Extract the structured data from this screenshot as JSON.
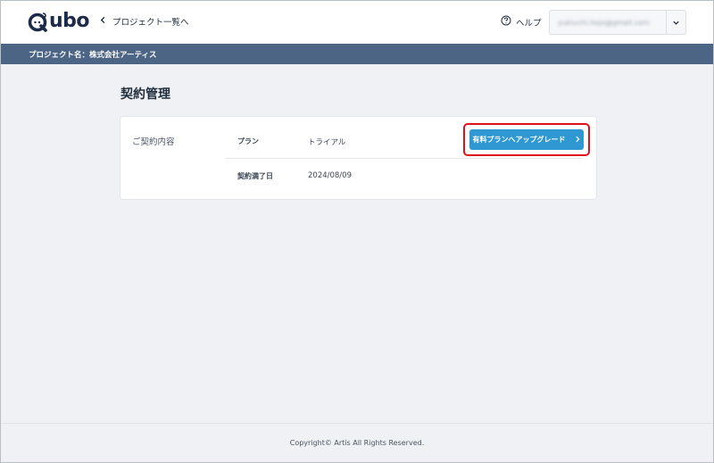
{
  "header": {
    "logo_text": "ubo",
    "back_label": "プロジェクト一覧へ",
    "help_label": "ヘルプ",
    "user_email": "yukiuchi.hojo@gmail.com"
  },
  "project_bar": {
    "label": "プロジェクト名：株式会社アーティス"
  },
  "main": {
    "title": "契約管理",
    "contract": {
      "section_label": "ご契約内容",
      "plan_label": "プラン",
      "plan_value": "トライアル",
      "expiry_label": "契約満了日",
      "expiry_value": "2024/08/09",
      "upgrade_label": "有料プランへアップグレード"
    }
  },
  "footer": {
    "copyright": "Copyright© Artis All Rights Reserved."
  },
  "colors": {
    "logo": "#1c2b4a",
    "project_bar": "#4d6584",
    "upgrade_button": "#2f97d1",
    "highlight": "#e0101a",
    "background": "#eff1f4"
  },
  "icons": {
    "back": "chevron-left-icon",
    "help": "question-circle-icon",
    "user_menu": "chevron-down-icon",
    "upgrade": "chevron-right-icon"
  }
}
